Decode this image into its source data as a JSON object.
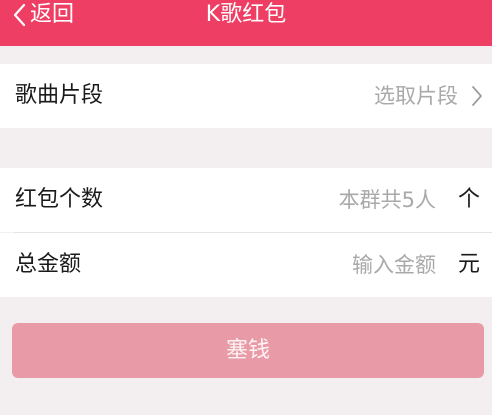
{
  "header": {
    "back_label": "返回",
    "title": "K歌红包"
  },
  "song_section": {
    "label": "歌曲片段",
    "value": "选取片段"
  },
  "form": {
    "count_label": "红包个数",
    "count_placeholder": "本群共5人",
    "count_unit": "个",
    "amount_label": "总金额",
    "amount_placeholder": "输入金额",
    "amount_unit": "元"
  },
  "submit": {
    "label": "塞钱"
  },
  "colors": {
    "accent": "#ee3e63",
    "button_disabled": "#e89ba6",
    "background": "#f3eff1",
    "placeholder": "#a9a9a9"
  }
}
